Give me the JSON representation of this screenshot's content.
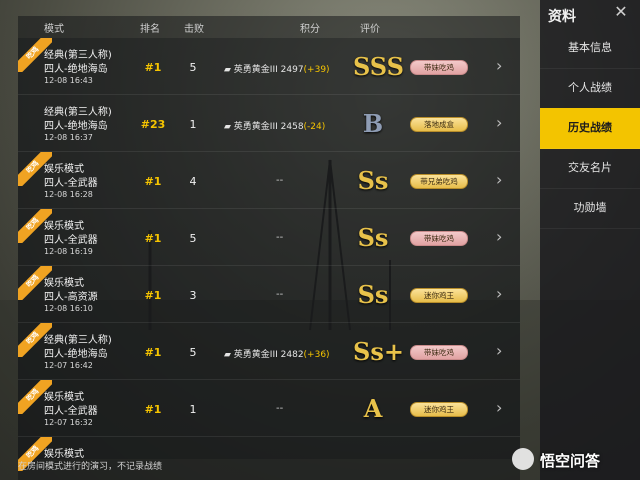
{
  "header": {
    "mode": "模式",
    "rank": "排名",
    "kills": "击败",
    "score": "积分",
    "grade": "评价"
  },
  "rows": [
    {
      "ribbon": "吃鸡",
      "mode1": "经典(第三人称)",
      "mode2": "四人-绝地海岛",
      "time": "12-08 16:43",
      "rank": "#1",
      "kills": "5",
      "score_tier": "英勇黄金III",
      "score_value": "2497",
      "score_delta": "(+39)",
      "grade": "SSS",
      "badge": "带妹吃鸡",
      "badge_color": "pink"
    },
    {
      "ribbon": "",
      "mode1": "经典(第三人称)",
      "mode2": "四人-绝地海岛",
      "time": "12-08 16:37",
      "rank": "#23",
      "kills": "1",
      "score_tier": "英勇黄金III",
      "score_value": "2458",
      "score_delta": "(-24)",
      "grade": "B",
      "badge": "落地成盒",
      "badge_color": "gold"
    },
    {
      "ribbon": "吃鸡",
      "mode1": "娱乐模式",
      "mode2": "四人-全武器",
      "time": "12-08 16:28",
      "rank": "#1",
      "kills": "4",
      "score_tier": "",
      "score_value": "--",
      "score_delta": "",
      "grade": "Ss",
      "badge": "带兄弟吃鸡",
      "badge_color": "gold"
    },
    {
      "ribbon": "吃鸡",
      "mode1": "娱乐模式",
      "mode2": "四人-全武器",
      "time": "12-08 16:19",
      "rank": "#1",
      "kills": "5",
      "score_tier": "",
      "score_value": "--",
      "score_delta": "",
      "grade": "Ss",
      "badge": "带妹吃鸡",
      "badge_color": "pink"
    },
    {
      "ribbon": "吃鸡",
      "mode1": "娱乐模式",
      "mode2": "四人-高资源",
      "time": "12-08 16:10",
      "rank": "#1",
      "kills": "3",
      "score_tier": "",
      "score_value": "--",
      "score_delta": "",
      "grade": "Ss",
      "badge": "迷你鸡王",
      "badge_color": "gold"
    },
    {
      "ribbon": "吃鸡",
      "mode1": "经典(第三人称)",
      "mode2": "四人-绝地海岛",
      "time": "12-07 16:42",
      "rank": "#1",
      "kills": "5",
      "score_tier": "英勇黄金III",
      "score_value": "2482",
      "score_delta": "(+36)",
      "grade": "Ss+",
      "badge": "带妹吃鸡",
      "badge_color": "pink"
    },
    {
      "ribbon": "吃鸡",
      "mode1": "娱乐模式",
      "mode2": "四人-全武器",
      "time": "12-07 16:32",
      "rank": "#1",
      "kills": "1",
      "score_tier": "",
      "score_value": "--",
      "score_delta": "",
      "grade": "A",
      "badge": "迷你鸡王",
      "badge_color": "gold"
    },
    {
      "ribbon": "吃鸡",
      "mode1": "娱乐模式",
      "mode2": "",
      "time": "",
      "rank": "",
      "kills": "",
      "score_tier": "",
      "score_value": "",
      "score_delta": "",
      "grade": "",
      "badge": "",
      "badge_color": ""
    }
  ],
  "sidebar": {
    "title": "资料",
    "close": "✕",
    "items": [
      "基本信息",
      "个人战绩",
      "历史战绩",
      "交友名片",
      "功勋墙"
    ],
    "active_index": 2
  },
  "footer_note": "在房间模式进行的演习，不记录战绩",
  "watermark": "悟空问答",
  "colors": {
    "accent": "#f3c400",
    "ribbon": "#f0a322"
  }
}
